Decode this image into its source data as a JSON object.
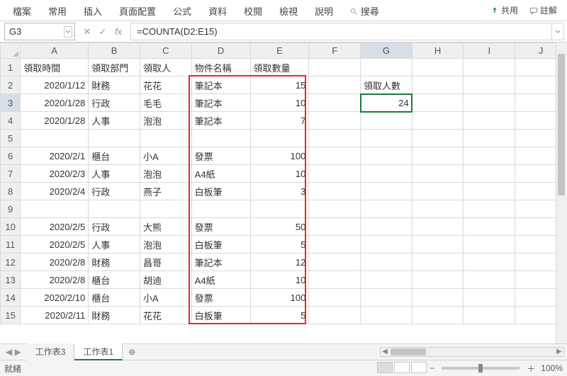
{
  "ribbon": {
    "tabs": [
      "檔案",
      "常用",
      "插入",
      "頁面配置",
      "公式",
      "資料",
      "校閱",
      "檢視",
      "說明",
      "搜尋"
    ],
    "share": "共用",
    "comment": "註解"
  },
  "namebox": "G3",
  "formula": "=COUNTA(D2:E15)",
  "columns": [
    "A",
    "B",
    "C",
    "D",
    "E",
    "F",
    "G",
    "H",
    "I",
    "J"
  ],
  "headers": {
    "A": "領取時間",
    "B": "領取部門",
    "C": "領取人",
    "D": "物件名稱",
    "E": "領取數量"
  },
  "extra": {
    "G1": "領取人數",
    "G3": "24"
  },
  "rows": [
    {
      "n": 1,
      "A": "",
      "B": "",
      "C": "",
      "D": "",
      "E": ""
    },
    {
      "n": 2,
      "A": "2020/1/12",
      "B": "財務",
      "C": "花花",
      "D": "筆記本",
      "E": "15"
    },
    {
      "n": 3,
      "A": "2020/1/28",
      "B": "行政",
      "C": "毛毛",
      "D": "筆記本",
      "E": "10"
    },
    {
      "n": 4,
      "A": "2020/1/28",
      "B": "人事",
      "C": "泡泡",
      "D": "筆記本",
      "E": "7"
    },
    {
      "n": 5,
      "A": "",
      "B": "",
      "C": "",
      "D": "",
      "E": ""
    },
    {
      "n": 6,
      "A": "2020/2/1",
      "B": "櫃台",
      "C": "小A",
      "D": "發票",
      "E": "100"
    },
    {
      "n": 7,
      "A": "2020/2/3",
      "B": "人事",
      "C": "泡泡",
      "D": "A4紙",
      "E": "10"
    },
    {
      "n": 8,
      "A": "2020/2/4",
      "B": "行政",
      "C": "燕子",
      "D": "白板筆",
      "E": "3"
    },
    {
      "n": 9,
      "A": "",
      "B": "",
      "C": "",
      "D": "",
      "E": ""
    },
    {
      "n": 10,
      "A": "2020/2/5",
      "B": "行政",
      "C": "大熊",
      "D": "發票",
      "E": "50"
    },
    {
      "n": 11,
      "A": "2020/2/5",
      "B": "人事",
      "C": "泡泡",
      "D": "白板筆",
      "E": "5"
    },
    {
      "n": 12,
      "A": "2020/2/8",
      "B": "財務",
      "C": "昌哥",
      "D": "筆記本",
      "E": "12"
    },
    {
      "n": 13,
      "A": "2020/2/8",
      "B": "櫃台",
      "C": "胡迪",
      "D": "A4紙",
      "E": "10"
    },
    {
      "n": 14,
      "A": "2020/2/10",
      "B": "櫃台",
      "C": "小A",
      "D": "發票",
      "E": "100"
    },
    {
      "n": 15,
      "A": "2020/2/11",
      "B": "財務",
      "C": "花花",
      "D": "白板筆",
      "E": "5"
    }
  ],
  "sheets": {
    "tabs": [
      "工作表3",
      "工作表1"
    ],
    "active": 1
  },
  "status": {
    "ready": "就緒",
    "zoom": "100%"
  }
}
